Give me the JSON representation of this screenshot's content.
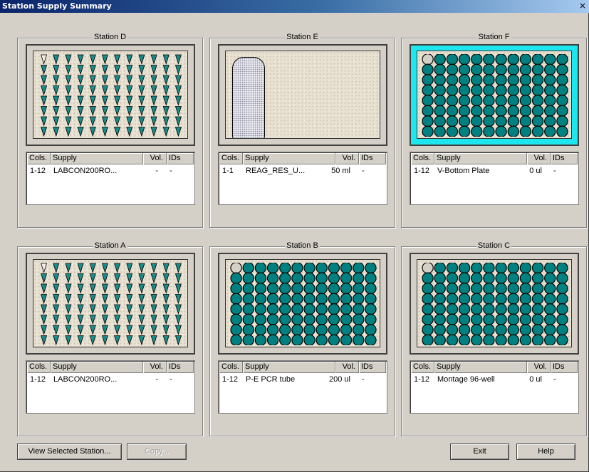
{
  "window": {
    "title": "Station Supply Summary",
    "close_glyph": "×"
  },
  "columns": {
    "cols": "Cols.",
    "supply": "Supply",
    "vol": "Vol.",
    "ids": "IDs"
  },
  "colors": {
    "well_fill": "#008080",
    "well_empty": "#d4d0c8",
    "tip_fill": "#1a8a8a",
    "selected_deck": "#1ee6ee"
  },
  "stations": [
    {
      "name": "Station D",
      "labware": "tips",
      "selected": false,
      "row": {
        "cols": "1-12",
        "supply": "LABCON200RO...",
        "vol": "-",
        "ids": "-"
      }
    },
    {
      "name": "Station E",
      "labware": "reservoir",
      "selected": false,
      "row": {
        "cols": "1-1",
        "supply": "REAG_RES_U...",
        "vol": "50 ml",
        "ids": "-"
      }
    },
    {
      "name": "Station F",
      "labware": "plate",
      "selected": true,
      "row": {
        "cols": "1-12",
        "supply": "V-Bottom Plate",
        "vol": "0 ul",
        "ids": "-"
      }
    },
    {
      "name": "Station A",
      "labware": "tips",
      "selected": false,
      "row": {
        "cols": "1-12",
        "supply": "LABCON200RO...",
        "vol": "-",
        "ids": "-"
      }
    },
    {
      "name": "Station B",
      "labware": "plate",
      "selected": false,
      "row": {
        "cols": "1-12",
        "supply": "P-E PCR tube",
        "vol": "200 ul",
        "ids": "-"
      }
    },
    {
      "name": "Station C",
      "labware": "plate",
      "selected": false,
      "row": {
        "cols": "1-12",
        "supply": "Montage 96-well",
        "vol": "0 ul",
        "ids": "-"
      }
    }
  ],
  "buttons": {
    "view_selected": "View Selected Station...",
    "copy": "Copy...",
    "exit": "Exit",
    "help": "Help"
  }
}
